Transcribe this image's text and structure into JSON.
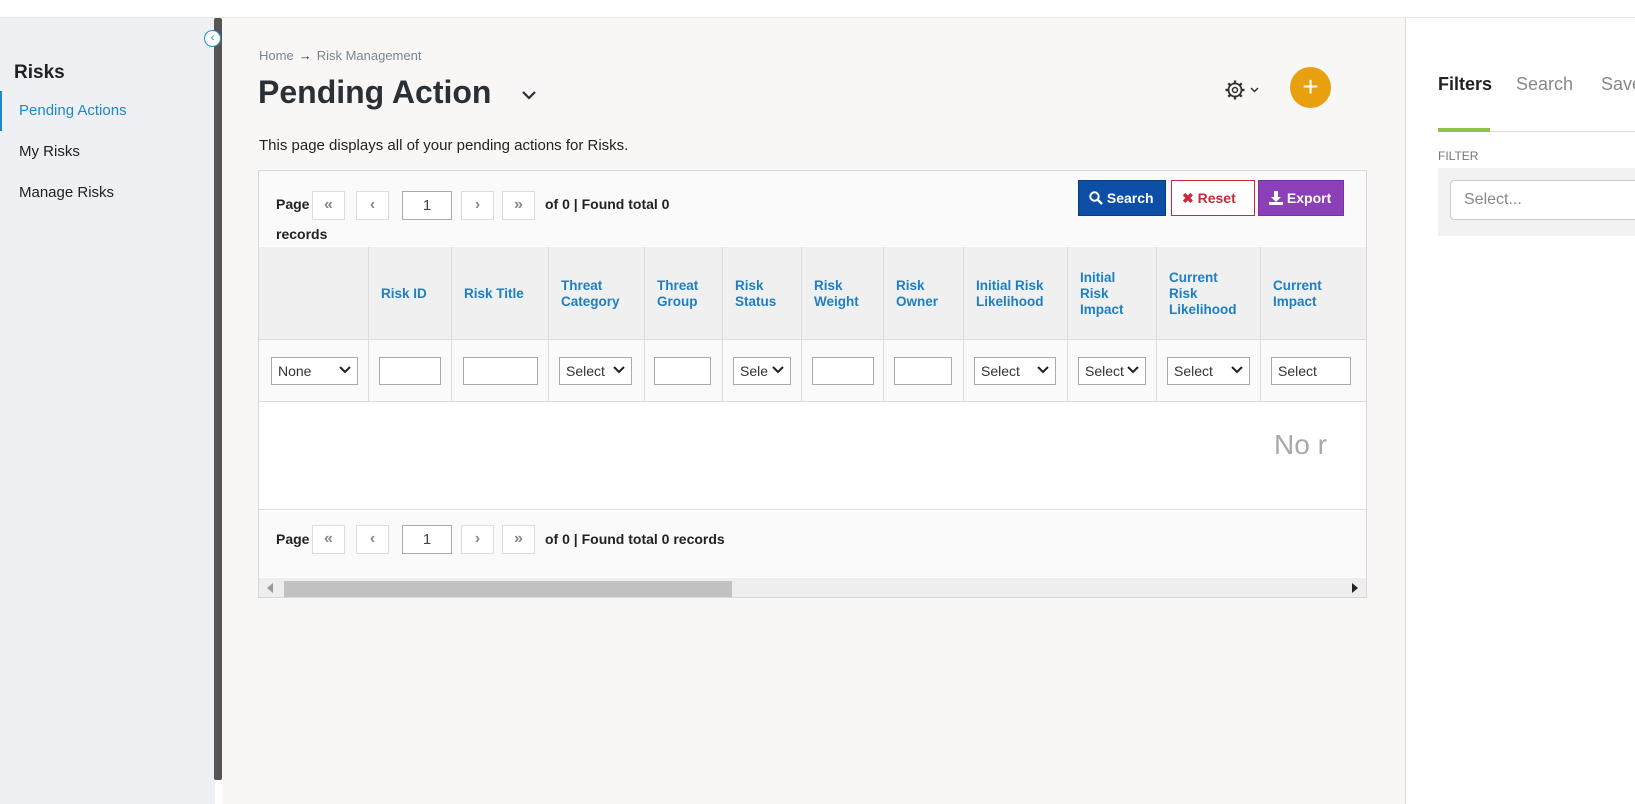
{
  "sidebar": {
    "title": "Risks",
    "items": [
      {
        "label": "Pending Actions",
        "active": true
      },
      {
        "label": "My Risks",
        "active": false
      },
      {
        "label": "Manage Risks",
        "active": false
      }
    ]
  },
  "breadcrumb": {
    "home": "Home",
    "arrow": "→",
    "current": "Risk Management"
  },
  "header": {
    "title": "Pending Action",
    "add_label": "+"
  },
  "description": "This page displays all of your pending actions for Risks.",
  "pager_top": {
    "page_label": "Page",
    "first": "«",
    "prev": "‹",
    "page_value": "1",
    "next": "›",
    "last": "»",
    "of_text": "of 0 | Found total 0",
    "records_text": "records"
  },
  "pager_bottom": {
    "page_label": "Page",
    "first": "«",
    "prev": "‹",
    "page_value": "1",
    "next": "›",
    "last": "»",
    "of_text": "of 0 | Found total 0 records"
  },
  "toolbar": {
    "search": "Search",
    "reset": "Reset",
    "export": "Export"
  },
  "columns": [
    {
      "label": ""
    },
    {
      "label": "Risk ID"
    },
    {
      "label": "Risk Title"
    },
    {
      "label": "Threat Category"
    },
    {
      "label": "Threat Group"
    },
    {
      "label": "Risk Status"
    },
    {
      "label": "Risk Weight"
    },
    {
      "label": "Risk Owner"
    },
    {
      "label": "Initial Risk Likelihood"
    },
    {
      "label": "Initial Risk Impact"
    },
    {
      "label": "Current Risk Likelihood"
    },
    {
      "label": "Current Impact"
    }
  ],
  "filters": {
    "first": "None",
    "threat_category": "Select",
    "risk_status": "Sele",
    "initial_likelihood": "Select",
    "initial_impact": "Select",
    "current_likelihood": "Select",
    "current_impact": "Select"
  },
  "empty_message": "No r",
  "right_panel": {
    "tabs": [
      {
        "label": "Filters",
        "active": true
      },
      {
        "label": "Search",
        "active": false
      },
      {
        "label": "Save",
        "active": false
      }
    ],
    "filter_label": "FILTER",
    "select_placeholder": "Select..."
  },
  "colors": {
    "accent_blue": "#1e88c8",
    "add_button": "#e8a00f",
    "search_btn": "#0d4fa6",
    "reset_btn": "#c92a3a",
    "export_btn": "#8b3fb8",
    "tab_underline": "#8bc34a"
  },
  "icons": {
    "collapse": "chevron-left-circle-icon",
    "gear": "gear-icon",
    "search": "search-icon",
    "reset": "x-icon",
    "export": "download-icon"
  }
}
